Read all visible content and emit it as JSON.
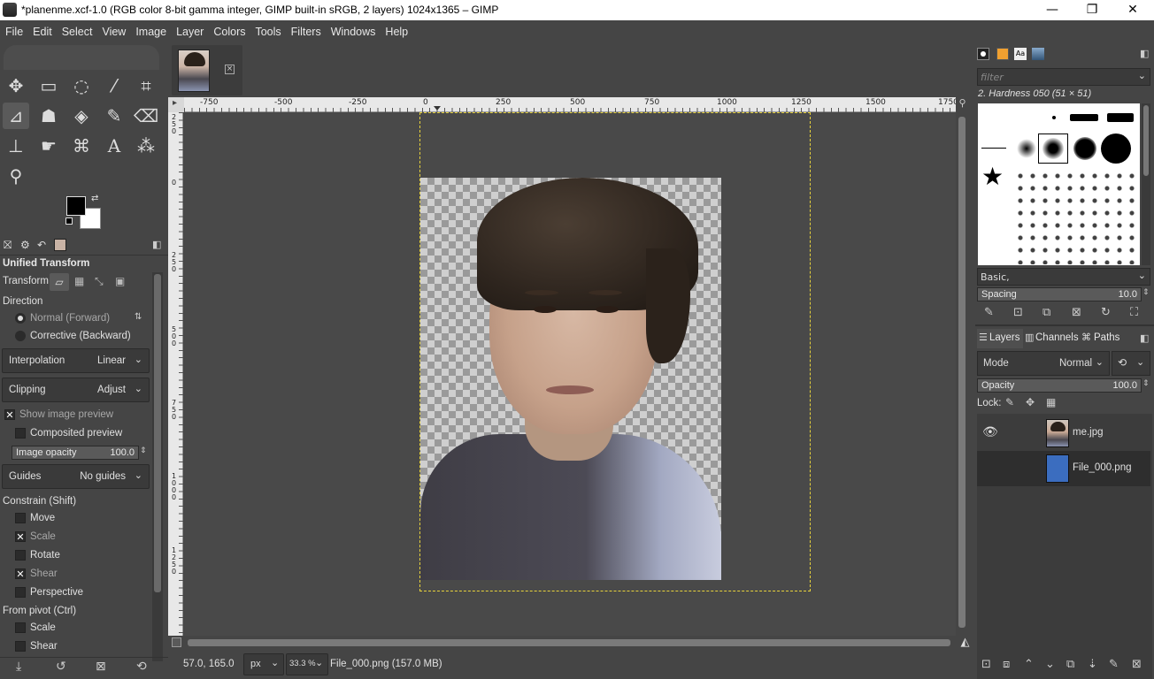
{
  "window": {
    "title": "*planenme.xcf-1.0 (RGB color 8-bit gamma integer, GIMP built-in sRGB, 2 layers) 1024x1365 – GIMP",
    "controls": {
      "minimize": "—",
      "maximize": "❐",
      "close": "✕"
    }
  },
  "menu": {
    "items": [
      "File",
      "Edit",
      "Select",
      "View",
      "Image",
      "Layer",
      "Colors",
      "Tools",
      "Filters",
      "Windows",
      "Help"
    ]
  },
  "tool_options": {
    "heading": "Unified Transform",
    "transform_label": "Transform:",
    "direction_label": "Direction",
    "direction_forward": "Normal (Forward)",
    "direction_backward": "Corrective (Backward)",
    "interpolation_label": "Interpolation",
    "interpolation_value": "Linear",
    "clipping_label": "Clipping",
    "clipping_value": "Adjust",
    "show_image_preview": "Show image preview",
    "composited_preview": "Composited preview",
    "image_opacity_label": "Image opacity",
    "image_opacity_value": "100.0",
    "guides_label": "Guides",
    "guides_value": "No guides",
    "constrain_label": "Constrain (Shift)",
    "constrain_move": "Move",
    "constrain_scale": "Scale",
    "constrain_rotate": "Rotate",
    "constrain_shear": "Shear",
    "constrain_perspective": "Perspective",
    "pivot_label": "From pivot  (Ctrl)",
    "pivot_scale": "Scale",
    "pivot_shear": "Shear",
    "checked": {
      "show_image_preview": true,
      "composited_preview": false,
      "move": false,
      "scale": true,
      "rotate": false,
      "shear": true,
      "perspective": false,
      "pivot_scale": false,
      "pivot_shear": false
    }
  },
  "rulers": {
    "horizontal": [
      "-750",
      "-500",
      "-250",
      "0",
      "250",
      "500",
      "750",
      "1000",
      "1250",
      "1500",
      "1750"
    ],
    "vertical": [
      "250",
      "0",
      "250",
      "500",
      "750",
      "1000",
      "1250"
    ]
  },
  "status": {
    "coords": "57.0, 165.0",
    "unit": "px",
    "zoom": "33.3 %",
    "info": "File_000.png (157.0 MB)"
  },
  "brushes": {
    "filter_placeholder": "filter",
    "selected": "2. Hardness 050 (51 × 51)",
    "preset": "Basic,",
    "spacing_label": "Spacing",
    "spacing_value": "10.0"
  },
  "layers_panel": {
    "tabs": [
      "Layers",
      "Channels",
      "Paths"
    ],
    "mode_label": "Mode",
    "mode_value": "Normal",
    "opacity_label": "Opacity",
    "opacity_value": "100.0",
    "lock_label": "Lock:",
    "layers": [
      {
        "name": "me.jpg",
        "visible": true
      },
      {
        "name": "File_000.png",
        "visible": false
      }
    ]
  },
  "colors": {
    "foreground": "#000000",
    "background": "#ffffff",
    "guide": "#e8d33c",
    "layer2_thumb": "#3b6dbf"
  }
}
